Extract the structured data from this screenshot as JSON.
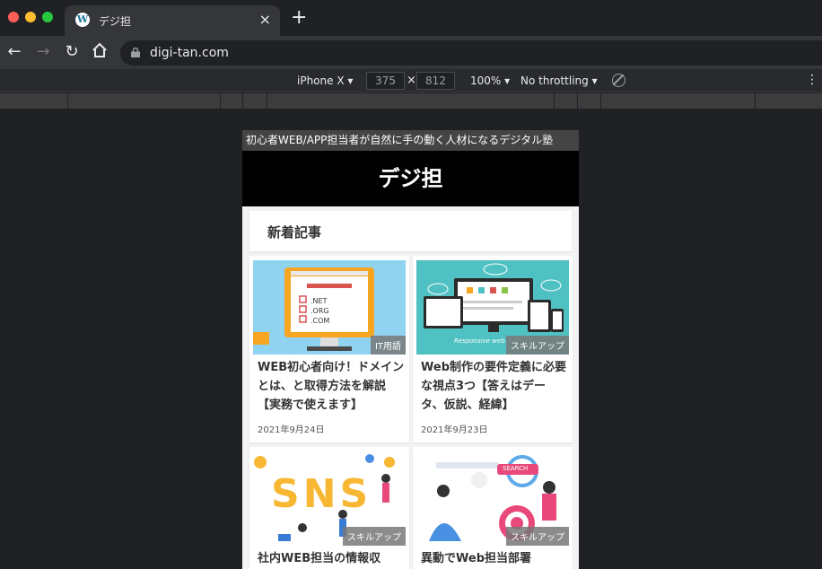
{
  "browser": {
    "tab_title": "デジ担",
    "url": "digi-tan.com",
    "favicon_letter": "W"
  },
  "devtools": {
    "device": "iPhone X ▾",
    "width": "375",
    "height": "812",
    "x_sep": "×",
    "zoom": "100% ▾",
    "throttle": "No throttling ▾",
    "more": "⋮"
  },
  "site": {
    "tagline": "初心者WEB/APP担当者が自然に手の動く人材になるデジタル塾",
    "site_title": "デジ担",
    "section_title": "新着記事"
  },
  "articles": [
    {
      "title": "WEB初心者向け！ドメインとは、と取得方法を解説【実務で使えます】",
      "date": "2021年9月24日",
      "category": "IT用語",
      "thumb_labels": [
        ".NET",
        ".ORG",
        ".COM"
      ]
    },
    {
      "title": "Web制作の要件定義に必要な視点3つ【答えはデータ、仮説、経緯】",
      "date": "2021年9月23日",
      "category": "スキルアップ",
      "thumb_labels": [
        "Responsive web"
      ]
    },
    {
      "title": "社内WEB担当の情報収",
      "date": "",
      "category": "スキルアップ",
      "thumb_labels": [
        "SNS"
      ]
    },
    {
      "title": "異動でWeb担当部署",
      "date": "",
      "category": "スキルアップ",
      "thumb_labels": [
        "SEARCH"
      ]
    }
  ],
  "colors": {
    "chrome_dark": "#202124",
    "chrome_toolbar": "#35363a",
    "header_bg": "#000000",
    "banner_bg": "#444444",
    "thumb1_bg": "#8fd3f0",
    "thumb2_bg": "#4fc1c2",
    "sns_yellow": "#f7b733",
    "search_pink": "#e8487a"
  }
}
